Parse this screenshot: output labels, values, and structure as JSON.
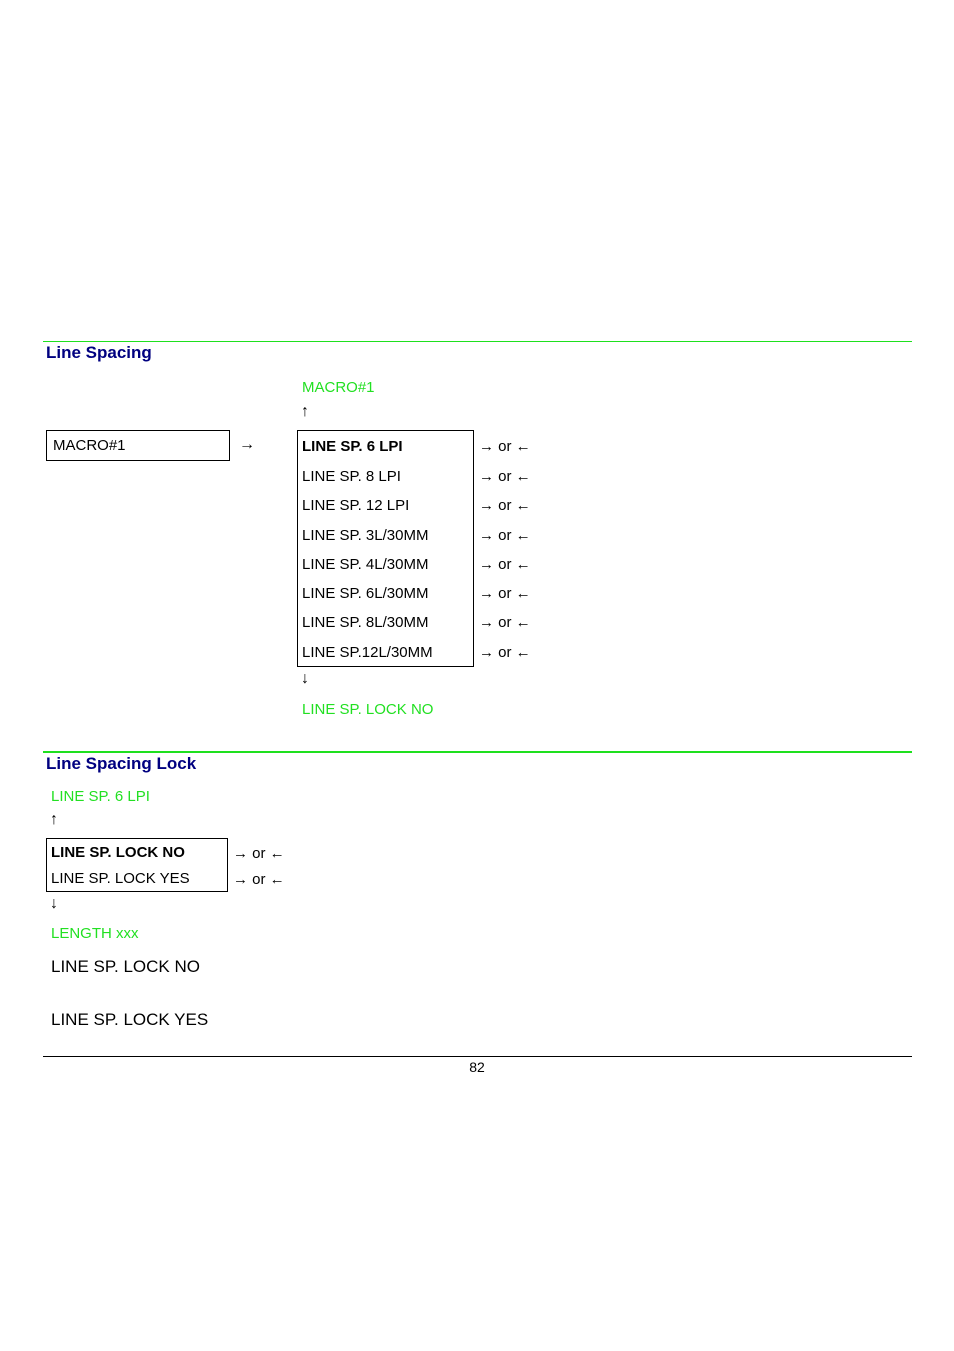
{
  "sections": {
    "line_spacing": {
      "title": "Line Spacing",
      "source_box": "MACRO#1",
      "flow_arrow": "→",
      "up_target": "MACRO#1",
      "up_arrow": "↑",
      "down_arrow": "↓",
      "down_target": "LINE SP. LOCK NO",
      "options": [
        {
          "label": "LINE SP. 6 LPI",
          "selected": true,
          "nav": "→ or ←"
        },
        {
          "label": "LINE SP. 8 LPI",
          "selected": false,
          "nav": "→ or ←"
        },
        {
          "label": "LINE SP. 12 LPI",
          "selected": false,
          "nav": "→ or ←"
        },
        {
          "label": "LINE SP. 3L/30MM",
          "selected": false,
          "nav": "→ or ←"
        },
        {
          "label": "LINE SP. 4L/30MM",
          "selected": false,
          "nav": "→ or ←"
        },
        {
          "label": "LINE SP. 6L/30MM",
          "selected": false,
          "nav": "→ or ←"
        },
        {
          "label": "LINE SP. 8L/30MM",
          "selected": false,
          "nav": "→ or ←"
        },
        {
          "label": "LINE SP.12L/30MM",
          "selected": false,
          "nav": "→ or ←"
        }
      ]
    },
    "line_spacing_lock": {
      "title": "Line Spacing Lock",
      "up_target": "LINE SP. 6 LPI",
      "up_arrow": "↑",
      "down_arrow": "↓",
      "down_target": "LENGTH xxx",
      "options": [
        {
          "label": "LINE SP. LOCK NO",
          "selected": true,
          "nav": "→ or ←"
        },
        {
          "label": "LINE SP. LOCK YES",
          "selected": false,
          "nav": "→ or ←"
        }
      ],
      "descriptions": [
        {
          "term": "LINE SP. LOCK NO"
        },
        {
          "term": "LINE SP. LOCK YES"
        }
      ]
    }
  },
  "footer": {
    "page_number": "82"
  },
  "colors": {
    "heading": "#000080",
    "menu_link": "#22e022",
    "rule_green": "#1ee01e"
  }
}
